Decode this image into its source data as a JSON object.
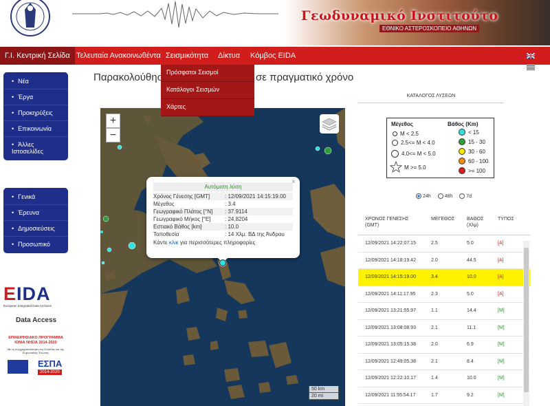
{
  "header": {
    "institute_name": "Γεωδυναμικό Ινστιτούτο",
    "institute_sub": "ΕΘΝΙΚΟ ΑΣΤΕΡΟΣΚΟΠΕΙΟ ΑΘΗΝΩΝ",
    "logo_text": "NATIONAL OBSERVATORY ATHENS"
  },
  "nav": {
    "items": [
      "Γ.Ι. Κεντρική Σελίδα",
      "Τελευταία Ανακοινωθέντα",
      "Σεισμικότητα",
      "Δίκτυα",
      "Κόμβος EIDA"
    ],
    "active_index": 0,
    "languages": [
      "English",
      "Ελληνικά"
    ]
  },
  "dropdown": {
    "items": [
      "Πρόσφατοι Σεισμοί",
      "Κατάλογοι Σεισμών",
      "Χάρτες"
    ]
  },
  "sidebar": {
    "group1": [
      "Νέα",
      "Έργα",
      "Προκηρύξεις",
      "Επικοινωνία",
      "Άλλες Ιστοσελίδες"
    ],
    "group2": [
      "Γενικά",
      "Έρευνα",
      "Δημοσιεύσεις",
      "Προσωπικό"
    ],
    "eida": "EIDA",
    "eida_sub": "European Integrated Data Archives",
    "data_access": "Data Access",
    "program_title": "ΕΠΙΧΕΙΡΗΣΙΑΚΟ ΠΡΟΓΡΑΜΜΑ ΙΟΝΙΑ ΝΗΣΙΑ 2014-2020",
    "program_sub": "Με τη συγχρηματοδότηση της Ελλάδας και της Ευρωπαϊκής Ένωσης",
    "espa": "ΕΣΠΑ",
    "espa_years": "2014-2020"
  },
  "page": {
    "title": "Παρακολούθηση της σεισμικότητας σε πραγματικό χρόνο"
  },
  "map": {
    "zoom_in": "+",
    "zoom_out": "−",
    "scale_km": "50 km",
    "scale_mi": "20 mi",
    "popup": {
      "title": "Αυτόματη λύση",
      "rows": [
        {
          "key": "Χρόνος Γένεσης [GMT]",
          "value": ": 12/09/2021 14:15:19.00"
        },
        {
          "key": "Μέγεθος",
          "value": ": 3.4"
        },
        {
          "key": "Γεωγραφικό Πλάτος [°N]",
          "value": ": 37.9114"
        },
        {
          "key": "Γεωγραφικό Μήκος [°E]",
          "value": ": 24.8204"
        },
        {
          "key": "Εστιακό Βάθος [km]",
          "value": ": 10.0"
        },
        {
          "key": "Τοποθεσία",
          "value": ": 14 Χλμ. ΒΔ της Άνδρου"
        }
      ],
      "more_prefix": "Κάντε",
      "more_link": "κλικ",
      "more_suffix": "για περισσότερες πληροφορίες",
      "close": "×"
    }
  },
  "legend": {
    "catalog_title": "ΚΑΤΑΛΟΓΟΣ ΛΥΣΕΩΝ",
    "magnitude_head": "Μέγεθος",
    "depth_head": "Βάθος (Km)",
    "magnitudes": [
      "M < 2.5",
      "2.5<= M < 4.0",
      "4.0<= M < 5.0",
      "M >= 5.0"
    ],
    "depths": [
      {
        "label": "< 15",
        "color": "#33e0e0"
      },
      {
        "label": "15 - 30",
        "color": "#2e9e3e"
      },
      {
        "label": "30 - 60",
        "color": "#f2e600"
      },
      {
        "label": "60 - 100",
        "color": "#f08a12"
      },
      {
        "label": ">= 100",
        "color": "#d21d1d"
      }
    ]
  },
  "periods": {
    "options": [
      "24h",
      "48h",
      "7d"
    ],
    "selected": 0
  },
  "table": {
    "headers": [
      "ΧΡΟΝΟΣ ΓΕΝΕΣΗΣ (GMT)",
      "ΜΕΓΕΘΟΣ",
      "ΒΑΘΟΣ (Χλμ)",
      "ΤΥΠΟΣ"
    ],
    "rows": [
      [
        "12/09/2021 14:22:07.15",
        "2.5",
        "5.0",
        "[A]"
      ],
      [
        "12/09/2021 14:18:19.42",
        "2.0",
        "44.5",
        "[A]"
      ],
      [
        "12/09/2021 14:15:19.00",
        "3.4",
        "10.0",
        "[A]"
      ],
      [
        "12/09/2021 14:11:17.95",
        "2.3",
        "5.0",
        "[A]"
      ],
      [
        "12/09/2021 13:21:55.97",
        "1.1",
        "14.4",
        "[M]"
      ],
      [
        "12/09/2021 13:08:08.93",
        "2.1",
        "11.1",
        "[M]"
      ],
      [
        "12/09/2021 13:05:15.38",
        "2.0",
        "6.9",
        "[M]"
      ],
      [
        "12/09/2021 12:49:05.38",
        "2.1",
        "8.4",
        "[M]"
      ],
      [
        "12/09/2021 12:22:10.17",
        "1.4",
        "10.0",
        "[M]"
      ],
      [
        "12/09/2021 11:55:54.17",
        "1.7",
        "9.2",
        "[M]"
      ]
    ],
    "highlight_index": 2
  },
  "colors": {
    "nav_red": "#d21d1d",
    "sidebar_blue": "#1f2e8a",
    "highlight": "#fff200",
    "sea": "#15375c",
    "land": "#6b5a3a"
  }
}
